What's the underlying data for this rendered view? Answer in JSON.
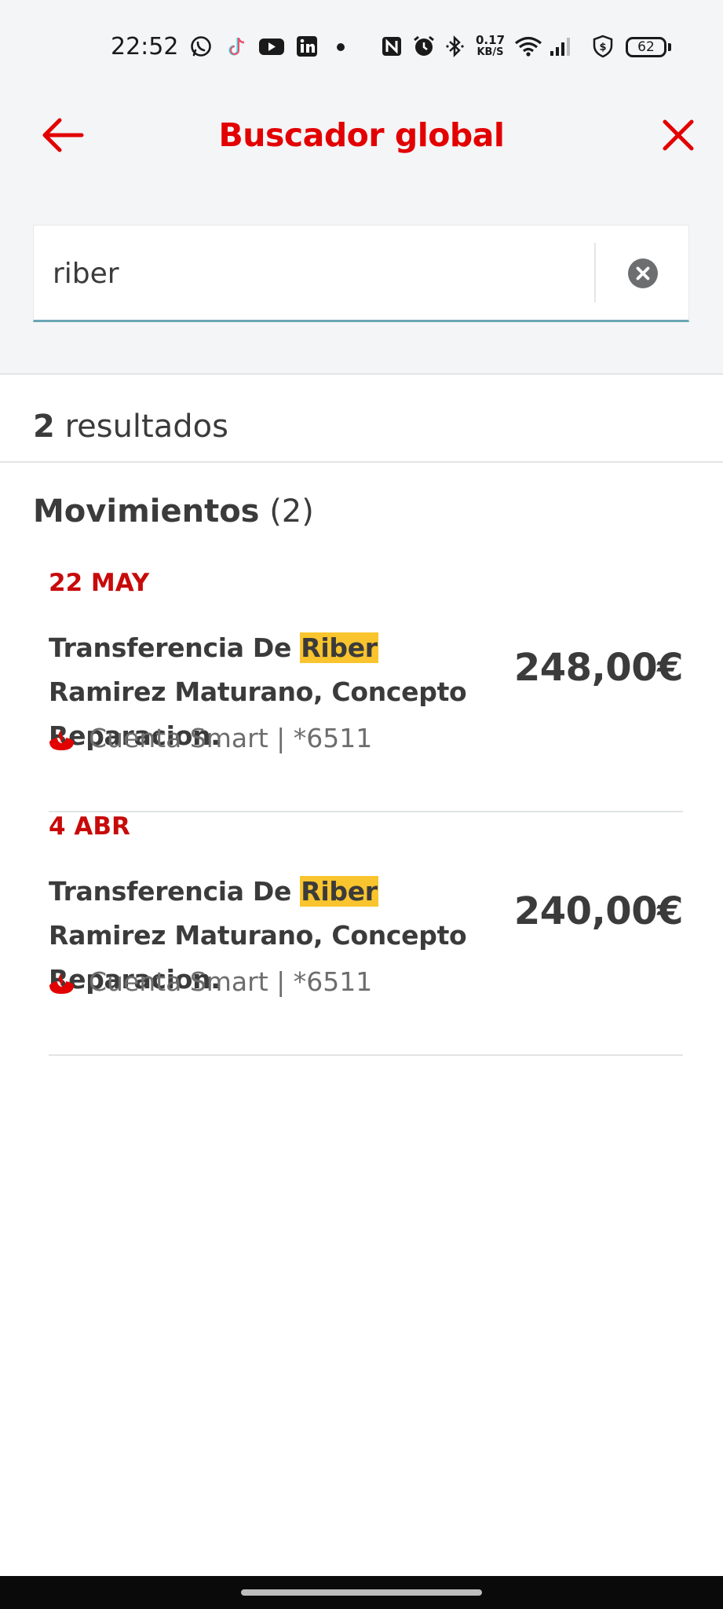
{
  "status_bar": {
    "time": "22:52",
    "speed_value": "0.17",
    "speed_unit": "KB/S",
    "battery": "62",
    "icons": [
      "whatsapp-icon",
      "tiktok-icon",
      "youtube-icon",
      "linkedin-icon",
      "notification-dot-icon",
      "nfc-icon",
      "alarm-icon",
      "bluetooth-icon",
      "wifi-icon",
      "signal-icon",
      "vpn-shield-icon",
      "battery-icon"
    ]
  },
  "header": {
    "title": "Buscador global",
    "back_icon": "arrow-left-icon",
    "close_icon": "close-icon"
  },
  "search": {
    "value": "riber",
    "placeholder": "",
    "clear_icon": "clear-circle-icon"
  },
  "results": {
    "count": "2",
    "label": "resultados"
  },
  "section": {
    "name": "Movimientos",
    "count": "(2)"
  },
  "movements": [
    {
      "date": "22 MAY",
      "desc_before": "Transferencia De ",
      "desc_highlight": "Riber",
      "desc_after": " Ramirez Maturano, Concepto Reparacion.",
      "account": "Cuenta Smart | *6511",
      "amount": "248,00€"
    },
    {
      "date": "4 ABR",
      "desc_before": "Transferencia De ",
      "desc_highlight": "Riber",
      "desc_after": " Ramirez Maturano, Concepto Reparacion.",
      "account": "Cuenta Smart | *6511",
      "amount": "240,00€"
    }
  ],
  "colors": {
    "brand_red": "#e20000",
    "date_red": "#c80a0a",
    "highlight": "#f9c42d",
    "input_underline": "#6aa6b4",
    "header_bg": "#f4f5f7"
  }
}
